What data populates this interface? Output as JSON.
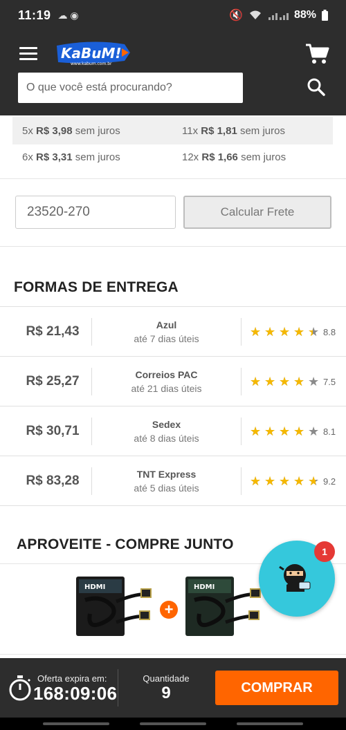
{
  "status_bar": {
    "time": "11:19",
    "battery": "88%"
  },
  "header": {
    "logo_text": "KaBuM!",
    "logo_sub": "www.kabum.com.br",
    "search_placeholder": "O que você está procurando?"
  },
  "installments": [
    {
      "count": "5x",
      "price": "R$ 3,98",
      "suffix": "sem juros"
    },
    {
      "count": "11x",
      "price": "R$ 1,81",
      "suffix": "sem juros"
    },
    {
      "count": "6x",
      "price": "R$ 3,31",
      "suffix": "sem juros"
    },
    {
      "count": "12x",
      "price": "R$ 1,66",
      "suffix": "sem juros"
    }
  ],
  "shipping": {
    "cep_value": "23520-270",
    "calc_label": "Calcular Frete"
  },
  "delivery": {
    "title": "FORMAS DE ENTREGA",
    "options": [
      {
        "price": "R$ 21,43",
        "name": "Azul",
        "days": "até 7 dias úteis",
        "rating": 8.8,
        "score": "8.8"
      },
      {
        "price": "R$ 25,27",
        "name": "Correios PAC",
        "days": "até 21 dias úteis",
        "rating": 7.5,
        "score": "7.5"
      },
      {
        "price": "R$ 30,71",
        "name": "Sedex",
        "days": "até 8 dias úteis",
        "rating": 8.1,
        "score": "8.1"
      },
      {
        "price": "R$ 83,28",
        "name": "TNT Express",
        "days": "até 5 dias úteis",
        "rating": 9.2,
        "score": "9.2"
      }
    ]
  },
  "buy_together": {
    "title": "APROVEITE - COMPRE JUNTO",
    "plus": "+",
    "product_label": "HDMI"
  },
  "chat": {
    "badge": "1"
  },
  "bottom_bar": {
    "offer_label": "Oferta expira em:",
    "offer_time": "168:09:06",
    "qty_label": "Quantidade",
    "qty_value": "9",
    "buy_label": "COMPRAR"
  },
  "colors": {
    "accent": "#ff6500",
    "header_bg": "#2d2d2d",
    "star": "#f5b800",
    "chat": "#35c8dc",
    "logo_blue": "#1a5fd8"
  }
}
